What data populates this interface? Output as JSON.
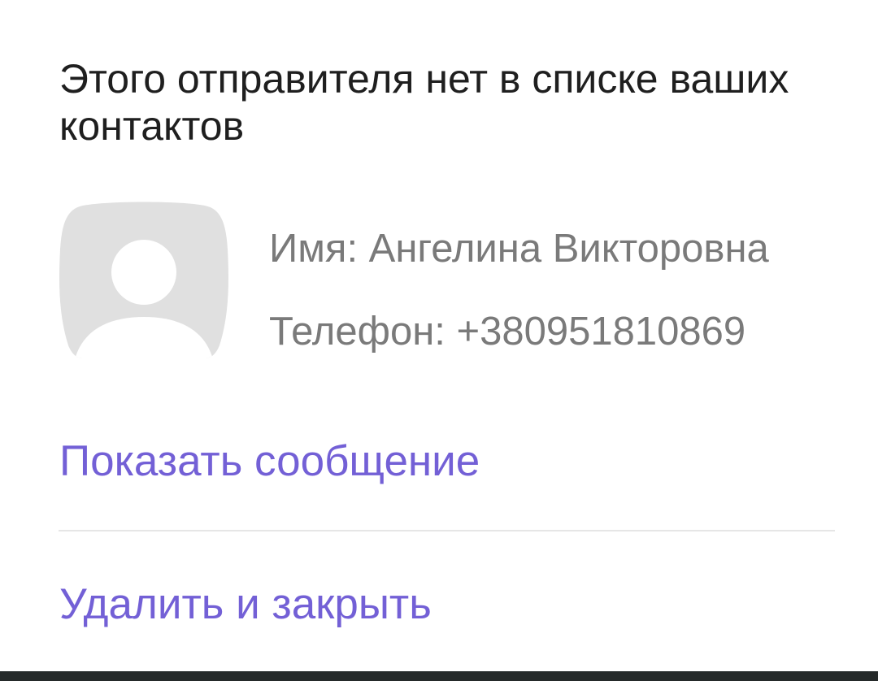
{
  "dialog": {
    "title": "Этого отправителя нет в списке ваших контактов",
    "sender": {
      "avatar_icon": "default-avatar-icon",
      "name_line": "Имя: Ангелина Викторовна",
      "phone_line": "Телефон: +380951810869"
    },
    "actions": {
      "show_message": "Показать сообщение",
      "delete_and_close": "Удалить и закрыть"
    }
  },
  "colors": {
    "accent": "#7360d6",
    "title_text": "#1f1f1f",
    "secondary_text": "#7a7a7a",
    "avatar_bg": "#e0e0e0",
    "divider": "#e6e6e6",
    "bottom_bar": "#252a2a"
  }
}
